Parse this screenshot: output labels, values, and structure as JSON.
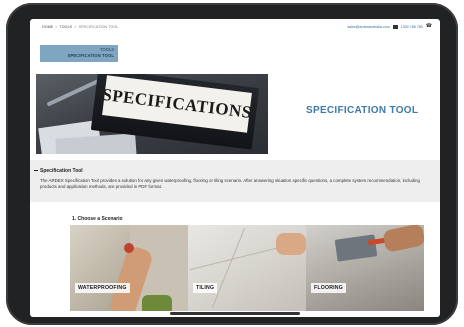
{
  "breadcrumb": {
    "home": "HOME",
    "tools": "TOOLS",
    "current": "SPECIFICATION TOOL",
    "separator": ">"
  },
  "contact": {
    "email": "sales@ardexaustralia.com",
    "phone": "1300 788 780",
    "email_icon": "mail-icon",
    "phone_icon": "phone-icon"
  },
  "tools_tab": {
    "line1": "TOOLS",
    "line2": "SPECIFICATION TOOL"
  },
  "hero": {
    "image_label": "SPECIFICATIONS",
    "title": "SPECIFICATION TOOL"
  },
  "intro": {
    "heading": "Specification Tool",
    "text": "The ARDEX Specification Tool provides a solution for any given waterproofing, flooring or tiling scenario. After answering situation specific questions, a complete system recommendation, including products and application methods, are provided in PDF format."
  },
  "scenario": {
    "heading": "1. Choose a Scenario",
    "tiles": [
      {
        "label": "WATERPROOFING"
      },
      {
        "label": "TILING"
      },
      {
        "label": "FLOORING"
      }
    ]
  },
  "colors": {
    "accent": "#3d7aa7",
    "tab_bg": "#7fa6c0",
    "band_bg": "#eeeeee",
    "device": "#202224"
  }
}
